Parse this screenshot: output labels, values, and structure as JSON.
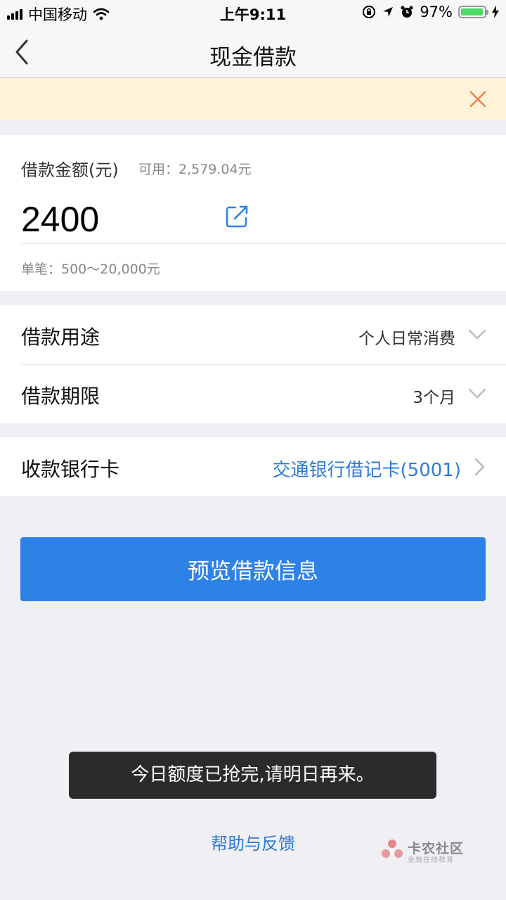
{
  "status_bar": {
    "carrier": "中国移动",
    "time": "上午9:11",
    "battery_percent": "97%",
    "battery_level": 0.97
  },
  "nav": {
    "title": "现金借款",
    "back_icon": "chevron-left-icon"
  },
  "notice": {
    "close_icon": "close-icon"
  },
  "amount": {
    "label": "借款金额(元)",
    "available": "可用：2,579.04元",
    "value": "2400",
    "edit_icon": "edit-icon",
    "range": "单笔：500～20,000元"
  },
  "options": {
    "purpose_label": "借款用途",
    "purpose_value": "个人日常消费",
    "term_label": "借款期限",
    "term_value": "3个月"
  },
  "bank": {
    "label": "收款银行卡",
    "value": "交通银行借记卡(5001)"
  },
  "primary_button": "预览借款信息",
  "toast": "今日额度已抢完,请明日再来。",
  "help_link": "帮助与反馈",
  "watermark": {
    "name": "卡农社区",
    "sub": "金融在线教育"
  },
  "colors": {
    "accent": "#2f82e5",
    "link": "#2e7bd6",
    "notice_bg": "#fdf3d9",
    "close": "#f07b4f"
  }
}
